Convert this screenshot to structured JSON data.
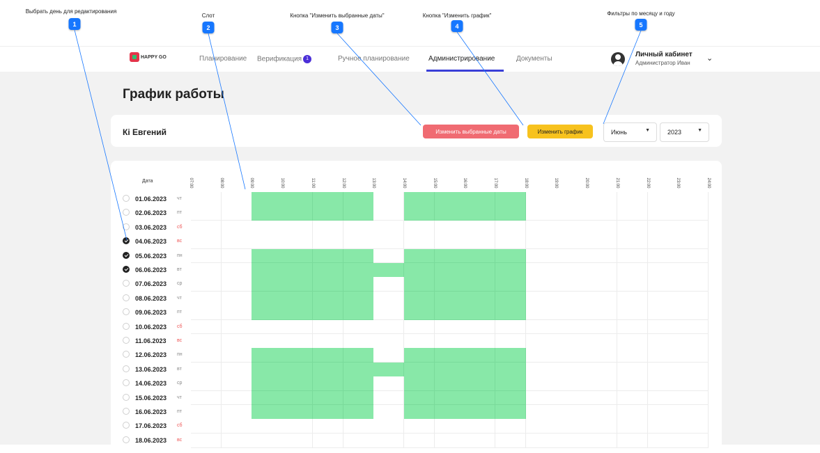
{
  "annotations": [
    {
      "num": "1",
      "label": "Выбрать день для редактирования"
    },
    {
      "num": "2",
      "label": "Слот"
    },
    {
      "num": "3",
      "label": "Кнопка \"Изменить выбранные даты\""
    },
    {
      "num": "4",
      "label": "Кнопка \"Изменить график\""
    },
    {
      "num": "5",
      "label": "Фильтры по месяцу и году"
    }
  ],
  "nav": {
    "logo": "HAPPY GO",
    "items": [
      "Планирование",
      "Верификация",
      "Ручное планирование",
      "Администрирование",
      "Документы"
    ],
    "verification_badge": "1",
    "active": "Администрирование",
    "profile_name": "Личный кабинет",
    "profile_role": "Администратор Иван"
  },
  "page": {
    "title": "График работы",
    "employee": "Кі Евгений",
    "btn_change_dates": "Изменить выбранные даты",
    "btn_change_schedule": "Изменить график",
    "month": "Июнь",
    "year": "2023"
  },
  "schedule": {
    "date_header": "Дата",
    "hours": [
      "07:00",
      "08:00",
      "09:00",
      "10:00",
      "11:00",
      "12:00",
      "13:00",
      "14:00",
      "15:00",
      "16:00",
      "17:00",
      "18:00",
      "19:00",
      "20:00",
      "21:00",
      "22:00",
      "23:00",
      "24:00"
    ],
    "rows": [
      {
        "date": "01.06.2023",
        "wd": "чт",
        "weekend": false,
        "checked": false,
        "slots": [
          [
            9,
            13
          ],
          [
            14,
            18
          ]
        ]
      },
      {
        "date": "02.06.2023",
        "wd": "пт",
        "weekend": false,
        "checked": false,
        "slots": [
          [
            9,
            13
          ],
          [
            14,
            18
          ]
        ]
      },
      {
        "date": "03.06.2023",
        "wd": "сб",
        "weekend": true,
        "checked": false,
        "slots": []
      },
      {
        "date": "04.06.2023",
        "wd": "вс",
        "weekend": true,
        "checked": true,
        "slots": []
      },
      {
        "date": "05.06.2023",
        "wd": "пн",
        "weekend": false,
        "checked": true,
        "slots": [
          [
            9,
            13
          ],
          [
            14,
            18
          ]
        ]
      },
      {
        "date": "06.06.2023",
        "wd": "вт",
        "weekend": false,
        "checked": true,
        "slots": [
          [
            9,
            18
          ]
        ]
      },
      {
        "date": "07.06.2023",
        "wd": "ср",
        "weekend": false,
        "checked": false,
        "slots": [
          [
            9,
            13
          ],
          [
            14,
            18
          ]
        ]
      },
      {
        "date": "08.06.2023",
        "wd": "чт",
        "weekend": false,
        "checked": false,
        "slots": [
          [
            9,
            13
          ],
          [
            14,
            18
          ]
        ]
      },
      {
        "date": "09.06.2023",
        "wd": "пт",
        "weekend": false,
        "checked": false,
        "slots": [
          [
            9,
            13
          ],
          [
            14,
            18
          ]
        ]
      },
      {
        "date": "10.06.2023",
        "wd": "сб",
        "weekend": true,
        "checked": false,
        "slots": []
      },
      {
        "date": "11.06.2023",
        "wd": "вс",
        "weekend": true,
        "checked": false,
        "slots": []
      },
      {
        "date": "12.06.2023",
        "wd": "пн",
        "weekend": false,
        "checked": false,
        "slots": [
          [
            9,
            13
          ],
          [
            14,
            18
          ]
        ]
      },
      {
        "date": "13.06.2023",
        "wd": "вт",
        "weekend": false,
        "checked": false,
        "slots": [
          [
            9,
            18
          ]
        ]
      },
      {
        "date": "14.06.2023",
        "wd": "ср",
        "weekend": false,
        "checked": false,
        "slots": [
          [
            9,
            13
          ],
          [
            14,
            18
          ]
        ]
      },
      {
        "date": "15.06.2023",
        "wd": "чт",
        "weekend": false,
        "checked": false,
        "slots": [
          [
            9,
            13
          ],
          [
            14,
            18
          ]
        ]
      },
      {
        "date": "16.06.2023",
        "wd": "пт",
        "weekend": false,
        "checked": false,
        "slots": [
          [
            9,
            13
          ],
          [
            14,
            18
          ]
        ]
      },
      {
        "date": "17.06.2023",
        "wd": "сб",
        "weekend": true,
        "checked": false,
        "slots": []
      },
      {
        "date": "18.06.2023",
        "wd": "вс",
        "weekend": true,
        "checked": false,
        "slots": []
      }
    ]
  }
}
